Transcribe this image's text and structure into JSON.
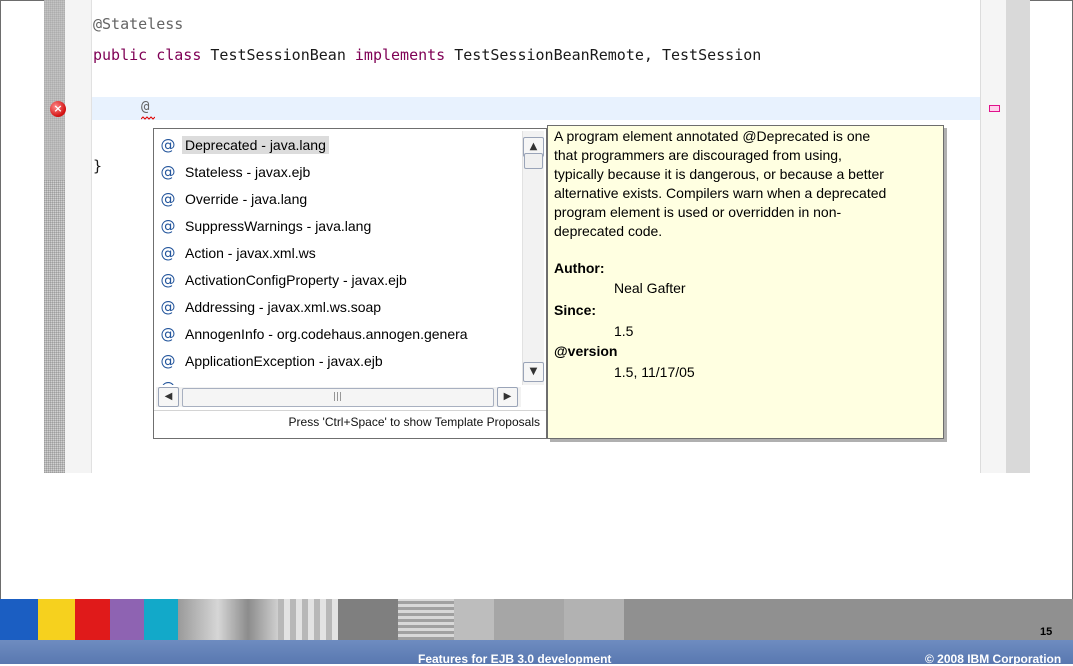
{
  "editor": {
    "code_lines": {
      "annotation": "@Stateless",
      "class_keywords": "public class",
      "class_name": " TestSessionBean ",
      "implements_keyword": "implements",
      "interfaces": " TestSessionBeanRemote, TestSession",
      "typed_text": "@",
      "closing_brace": "}"
    }
  },
  "completion_popup": {
    "proposals": [
      {
        "label": "Deprecated - java.lang",
        "icon": "annotation-icon",
        "selected": true
      },
      {
        "label": "Stateless - javax.ejb",
        "icon": "annotation-icon"
      },
      {
        "label": "Override - java.lang",
        "icon": "annotation-icon"
      },
      {
        "label": "SuppressWarnings - java.lang",
        "icon": "annotation-icon"
      },
      {
        "label": "Action - javax.xml.ws",
        "icon": "annotation-icon"
      },
      {
        "label": "ActivationConfigProperty - javax.ejb",
        "icon": "annotation-icon"
      },
      {
        "label": "Addressing - javax.xml.ws.soap",
        "icon": "annotation-icon"
      },
      {
        "label": "AnnogenInfo - org.codehaus.annogen.genera",
        "icon": "annotation-icon"
      },
      {
        "label": "ApplicationException - javax.ejb",
        "icon": "annotation-icon"
      }
    ],
    "status_text": "Press 'Ctrl+Space' to show Template Proposals"
  },
  "javadoc": {
    "description_lines": [
      "A program element annotated @Deprecated is one",
      "that programmers are discouraged from using,",
      "typically because it is dangerous, or because a better",
      "alternative exists. Compilers warn when a deprecated",
      "program element is used or overridden in non-",
      "deprecated code."
    ],
    "author_label": "Author:",
    "author_value": "Neal Gafter",
    "since_label": "Since:",
    "since_value": "1.5",
    "version_label": "@version",
    "version_value": "1.5, 11/17/05"
  },
  "footer": {
    "page_number": "15",
    "title": "Features for EJB 3.0 development",
    "copyright": "© 2008 IBM Corporation",
    "tile_colors": [
      "#1b5ec2",
      "#f6d11e",
      "#e01a1a",
      "#8e63b2",
      "#12a9c9"
    ]
  }
}
